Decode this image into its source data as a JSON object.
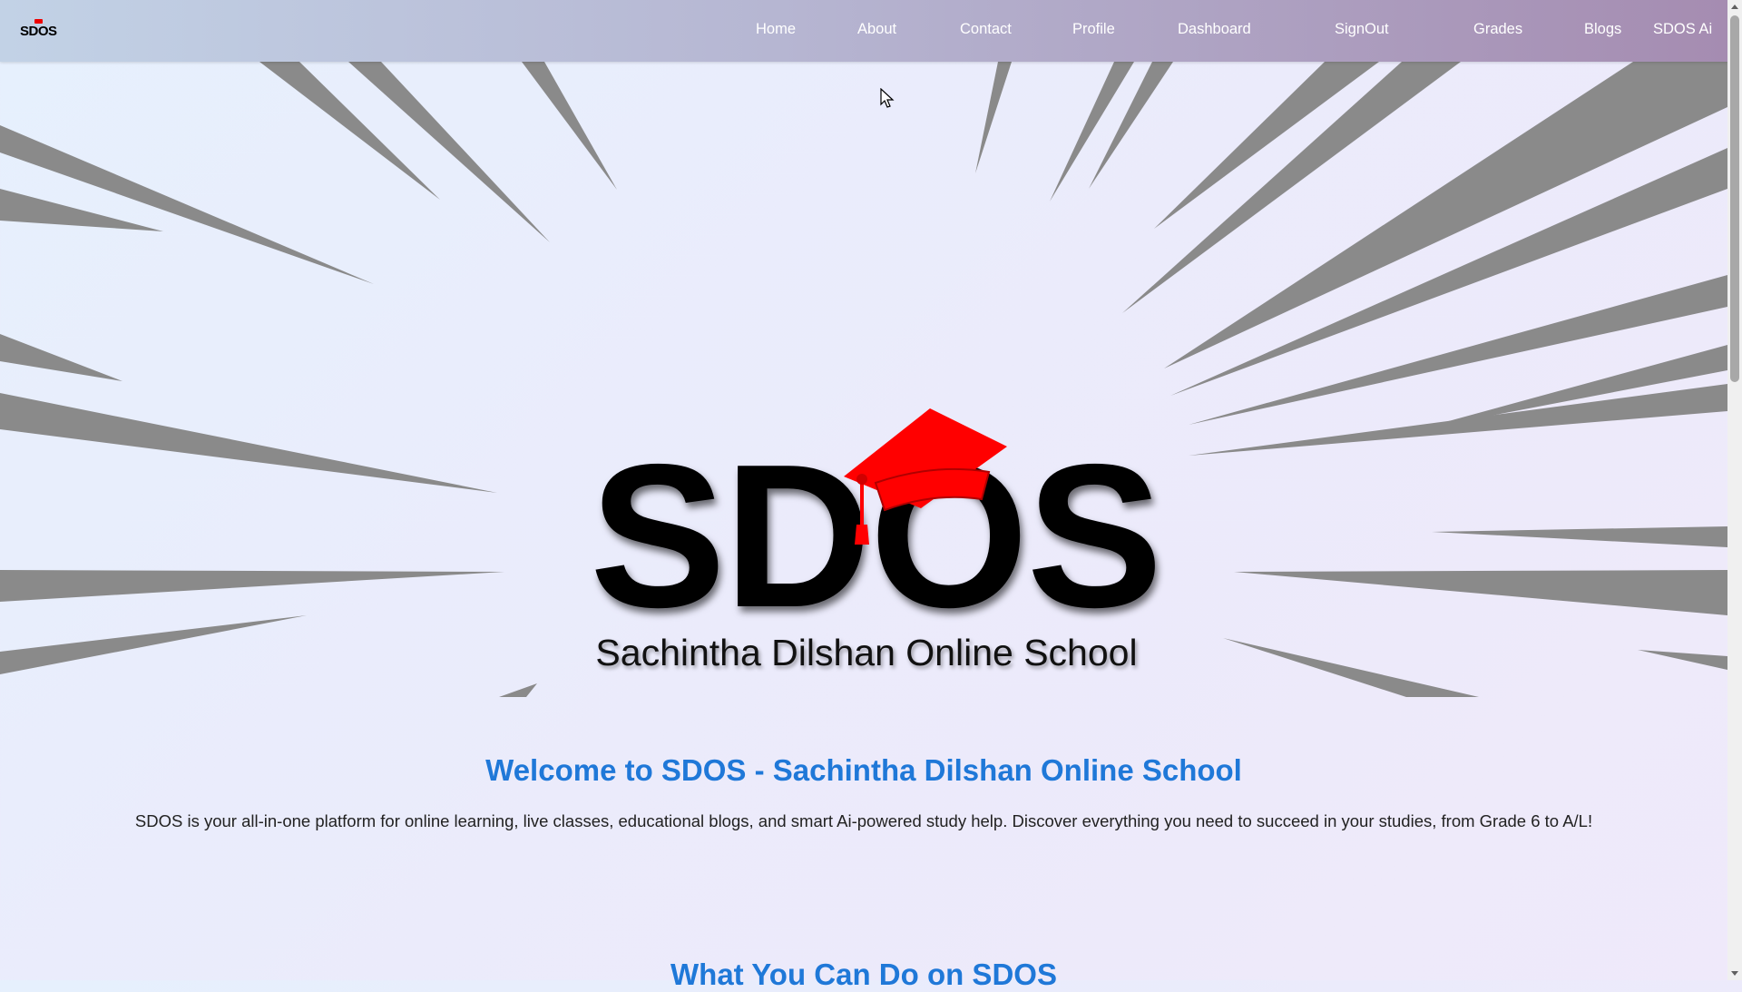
{
  "navbar": {
    "logo_text": "SDOS",
    "links": [
      "Home",
      "About",
      "Contact",
      "Profile",
      "Dashboard",
      "SignOut",
      "Grades",
      "Blogs",
      "SDOS Ai"
    ]
  },
  "hero": {
    "logo_text": "SDOS",
    "logo_subtitle": "Sachintha Dilshan Online School",
    "cap_color": "#ff0000"
  },
  "welcome": {
    "heading": "Welcome to SDOS - Sachintha Dilshan Online School",
    "description": "SDOS is your all-in-one platform for online learning, live classes, educational blogs, and smart Ai-powered study help. Discover everything you need to succeed in your studies, from Grade 6 to A/L!"
  },
  "next_section": {
    "heading": "What You Can Do on SDOS"
  },
  "colors": {
    "accent": "#1f78d8",
    "ray": "#8a8a8a"
  }
}
